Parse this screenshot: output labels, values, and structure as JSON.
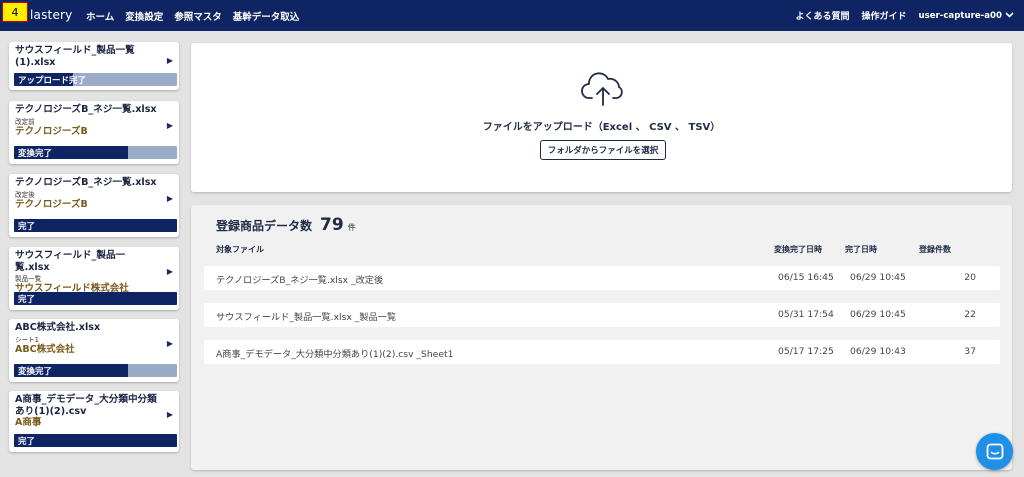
{
  "badge": "4",
  "brand": "lastery",
  "nav": [
    "ホーム",
    "変換設定",
    "参照マスタ",
    "基幹データ取込"
  ],
  "right_nav": {
    "faq": "よくある質問",
    "guide": "操作ガイド",
    "user": "user-capture-a00",
    "chevron": "⌄"
  },
  "sidebar": [
    {
      "name": "サウスフィールド_製品一覧(1).xlsx",
      "sub": "",
      "company": "",
      "status": "アップロード完了",
      "progress": 0.36
    },
    {
      "name": "テクノロジーズB_ネジ一覧.xlsx",
      "sub": "改定前",
      "company": "テクノロジーズB",
      "status": "変換完了",
      "progress": 0.7
    },
    {
      "name": "テクノロジーズB_ネジ一覧.xlsx",
      "sub": "改定後",
      "company": "テクノロジーズB",
      "status": "完了",
      "progress": 1.0
    },
    {
      "name": "サウスフィールド_製品一覧.xlsx",
      "sub": "製品一覧",
      "company": "サウスフィールド株式会社",
      "status": "完了",
      "progress": 1.0
    },
    {
      "name": "ABC株式会社.xlsx",
      "sub": "シート1",
      "company": "ABC株式会社",
      "status": "変換完了",
      "progress": 0.7
    },
    {
      "name": "A商事_デモデータ_大分類中分類あり(1)(2).csv",
      "sub": "",
      "company": "A商事",
      "status": "完了",
      "progress": 1.0
    }
  ],
  "upload": {
    "title": "ファイルをアップロード（Excel 、 CSV 、 TSV）",
    "button": "フォルダからファイルを選択"
  },
  "registered": {
    "title": "登録商品データ数",
    "count": "79",
    "unit": "件",
    "columns": [
      "対象ファイル",
      "変換完了日時",
      "完了日時",
      "登録件数"
    ],
    "rows": [
      {
        "file": "テクノロジーズB_ネジ一覧.xlsx _改定後",
        "converted": "06/15 16:45",
        "completed": "06/29 10:45",
        "count": "20"
      },
      {
        "file": "サウスフィールド_製品一覧.xlsx _製品一覧",
        "converted": "05/31 17:54",
        "completed": "06/29 10:45",
        "count": "22"
      },
      {
        "file": "A商事_デモデータ_大分類中分類あり(1)(2).csv _Sheet1",
        "converted": "05/17 17:25",
        "completed": "06/29 10:43",
        "count": "37"
      }
    ]
  },
  "colors": {
    "navy": "#0f2563",
    "bar_bg": "#9aabc8",
    "company": "#7a5a1a",
    "chat": "#1e90e6"
  },
  "icons": {
    "upload": "cloud-upload-icon",
    "play": "play-arrow-icon",
    "chat": "chat-icon"
  }
}
